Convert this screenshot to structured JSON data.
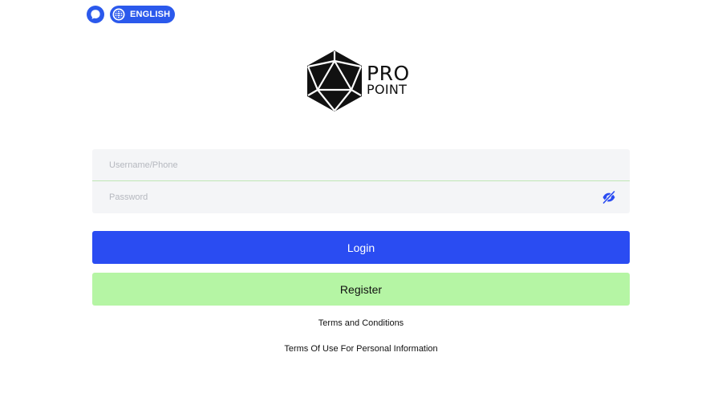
{
  "header": {
    "support_icon": "chat-bubble-icon",
    "language": {
      "icon": "globe-icon",
      "label": "ENGLISH"
    }
  },
  "logo": {
    "icon": "d20-dice-icon",
    "line1": "PRO",
    "line2": "POINT"
  },
  "form": {
    "username_placeholder": "Username/Phone",
    "username_value": "",
    "password_placeholder": "Password",
    "password_value": "",
    "password_toggle_icon": "eye-slash-icon"
  },
  "actions": {
    "login_label": "Login",
    "register_label": "Register"
  },
  "links": {
    "terms": "Terms and Conditions",
    "privacy": "Terms Of Use For Personal Information"
  },
  "colors": {
    "primary": "#2a4cf2",
    "secondary": "#b5f5a4",
    "field_bg": "#f4f5f7"
  }
}
